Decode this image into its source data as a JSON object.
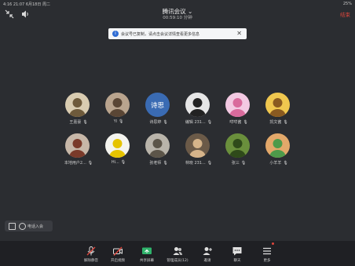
{
  "status_bar": {
    "left": "4:16 21:07 6月18日 周二",
    "right": "25% "
  },
  "header": {
    "title": "腾讯会议",
    "subtitle": "00:59:10 分钟",
    "end_label": "结束"
  },
  "notice": {
    "text": "会议号已复制，请点击会议详情查看更多信息",
    "close": "✕"
  },
  "participants": [
    {
      "name": "王嘉豪",
      "bg": "#d9ccb1",
      "fg": "#6e5a3b"
    },
    {
      "name": "Yi",
      "bg": "#b9a48e",
      "fg": "#5a4635"
    },
    {
      "name": "诗思婷",
      "bg": "#3a6bb3",
      "fg": "#ffffff",
      "initials": "诗思"
    },
    {
      "name": "编辑 231...",
      "bg": "#e6e6e6",
      "fg": "#222222"
    },
    {
      "name": "咩咩酱",
      "bg": "#f3c9e2",
      "fg": "#d96a9c"
    },
    {
      "name": "凯文酱",
      "bg": "#f0c74f",
      "fg": "#8a5a20"
    },
    {
      "name": "本地用户2...",
      "bg": "#c7b7a8",
      "fg": "#7a3a2a"
    },
    {
      "name": "Hi...",
      "bg": "#f4f4ef",
      "fg": "#e5c300"
    },
    {
      "name": "张老师",
      "bg": "#b9b4aa",
      "fg": "#5c5549"
    },
    {
      "name": "林晓 231...",
      "bg": "#6b5a48",
      "fg": "#d6b48a"
    },
    {
      "name": "张三",
      "bg": "#6a8f3c",
      "fg": "#2f4a1a"
    },
    {
      "name": "小羊羊",
      "bg": "#e3a86a",
      "fg": "#4e9a4a"
    }
  ],
  "left_controls": {
    "label": "电话入会"
  },
  "toolbar": [
    {
      "label": "解除静音",
      "icon": "mic-muted-icon"
    },
    {
      "label": "开启视频",
      "icon": "video-off-icon"
    },
    {
      "label": "共享屏幕",
      "icon": "share-screen-icon"
    },
    {
      "label": "管理成员(12)",
      "icon": "members-icon"
    },
    {
      "label": "邀请",
      "icon": "invite-icon"
    },
    {
      "label": "聊天",
      "icon": "chat-icon"
    },
    {
      "label": "更多",
      "icon": "more-icon"
    }
  ],
  "colors": {
    "accent": "#2e6bd4",
    "danger": "#e0463c",
    "share": "#2fb36b"
  }
}
